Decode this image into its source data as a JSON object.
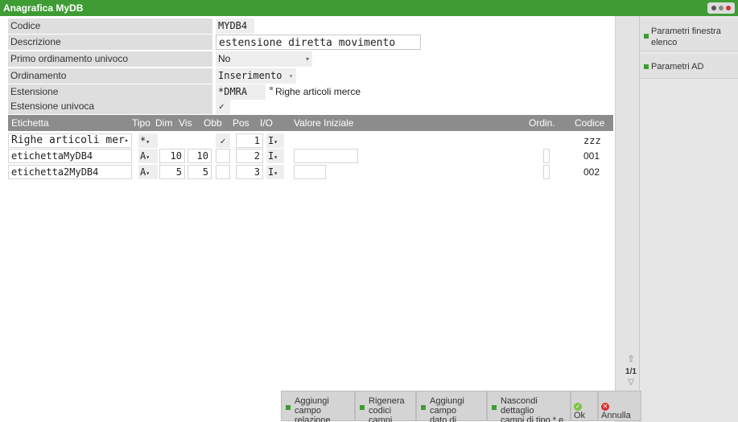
{
  "window": {
    "title": "Anagrafica MyDB"
  },
  "form": {
    "codice": {
      "label": "Codice",
      "value": "MYDB4"
    },
    "descrizione": {
      "label": "Descrizione",
      "value": "estensione diretta movimento"
    },
    "primo_ordinamento": {
      "label": "Primo ordinamento univoco",
      "value": "No"
    },
    "ordinamento": {
      "label": "Ordinamento",
      "value": "Inserimento"
    },
    "estensione": {
      "label": "Estensione",
      "value": "*DMRA",
      "desc": "Righe articoli merce"
    },
    "estensione_univoca": {
      "label": "Estensione univoca",
      "checked": true,
      "mark": "✓"
    }
  },
  "grid": {
    "columns": [
      "Etichetta",
      "Tipo",
      "Dim",
      "Vis",
      "Obb",
      "Pos",
      "I/O",
      "Valore Iniziale",
      "Ordin.",
      "Codice"
    ],
    "rows": [
      {
        "etichetta": "Righe articoli mer",
        "tipo": "*",
        "dim": "",
        "vis": "",
        "obb": "✓",
        "pos": "1",
        "io": "I",
        "valore": "",
        "codice": "zzz"
      },
      {
        "etichetta": "etichettaMyDB4",
        "tipo": "A",
        "dim": "10",
        "vis": "10",
        "obb": "",
        "pos": "2",
        "io": "I",
        "valore": "",
        "codice": "001"
      },
      {
        "etichetta": "etichetta2MyDB4",
        "tipo": "A",
        "dim": "5",
        "vis": "5",
        "obb": "",
        "pos": "3",
        "io": "I",
        "valore": "",
        "codice": "002"
      }
    ]
  },
  "scroll": {
    "page": "1/1"
  },
  "buttons": {
    "aggiungi_relazione": {
      "line1": "Aggiungi campo",
      "line2": "relazione"
    },
    "rigenera": {
      "line1": "Rigenera",
      "line2": "codici campi"
    },
    "aggiungi_sistema": {
      "line1": "Aggiungi campo",
      "line2": "dato di sistema"
    },
    "nascondi": {
      "line1": "Nascondi dettaglio",
      "line2": "campi di tipo * e -"
    },
    "ok": "Ok",
    "annulla": "Annulla"
  },
  "right_panel": {
    "parametri_finestra": {
      "line1": "Parametri finestra",
      "line2": "elenco"
    },
    "parametri_ad": "Parametri AD"
  },
  "colors": {
    "accent": "#3f9c35",
    "header": "#8c8c8c"
  }
}
